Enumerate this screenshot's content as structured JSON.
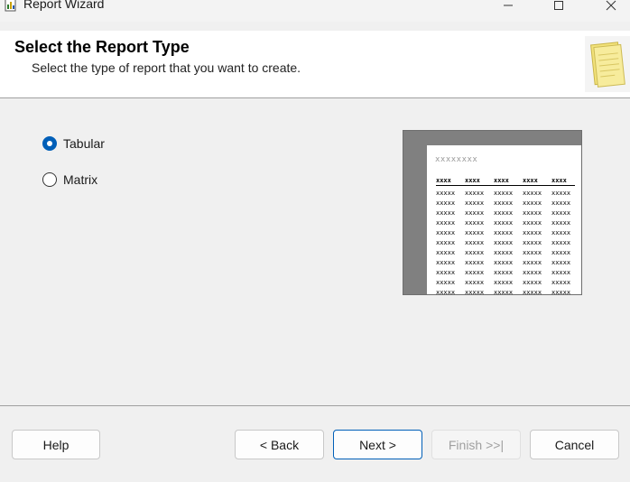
{
  "window": {
    "title": "Report Wizard",
    "minimize_symbol": "—",
    "maximize_symbol": "☐",
    "close_symbol": "✕"
  },
  "header": {
    "title": "Select the Report Type",
    "subtitle": "Select the type of report that you want to create.",
    "graphic_icon": "report-document-icon"
  },
  "options": [
    {
      "label": "Tabular",
      "selected": true
    },
    {
      "label": "Matrix",
      "selected": false
    }
  ],
  "preview": {
    "title": "xxxxxxxx",
    "headers": [
      "xxxx",
      "xxxx",
      "xxxx",
      "xxxx",
      "xxxx"
    ],
    "cell": "xxxxx"
  },
  "buttons": {
    "help": "Help",
    "back": "< Back",
    "next": "Next >",
    "finish": "Finish >>|",
    "cancel": "Cancel"
  },
  "colors": {
    "accent": "#005fb8",
    "header_background": "#ffffff",
    "body_background": "#f0f0f0",
    "preview_frame": "#808080"
  }
}
